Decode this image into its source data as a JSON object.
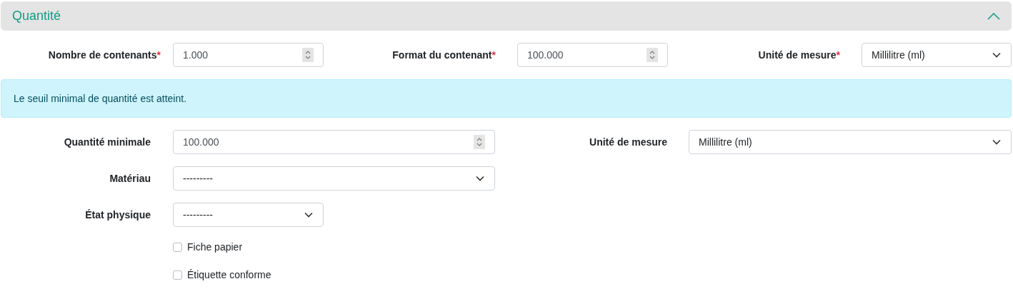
{
  "section": {
    "title": "Quantité",
    "expanded": true
  },
  "top_fields": [
    {
      "label": "Nombre de contenants",
      "marker": "*",
      "kind": "number",
      "value": "1.000"
    },
    {
      "label": "Format du contenant",
      "marker": "*",
      "kind": "number",
      "value": "100.000"
    },
    {
      "label": "Unité de mesure",
      "marker": "*",
      "kind": "select",
      "value": "Millilitre (ml)"
    }
  ],
  "alert": {
    "text": "Le seuil minimal de quantité est atteint."
  },
  "fields": [
    {
      "label": "Quantité minimale",
      "kind": "number",
      "value": "100.000"
    },
    {
      "label": "Unité de mesure",
      "kind": "select",
      "value": "Millilitre (ml)"
    },
    {
      "label": "Matériau",
      "kind": "select",
      "value": "---------"
    },
    {
      "label": "État physique",
      "kind": "select",
      "value": "---------"
    }
  ],
  "checkboxes": [
    {
      "label": "Fiche papier",
      "checked": false
    },
    {
      "label": "Étiquette conforme",
      "checked": false
    }
  ]
}
